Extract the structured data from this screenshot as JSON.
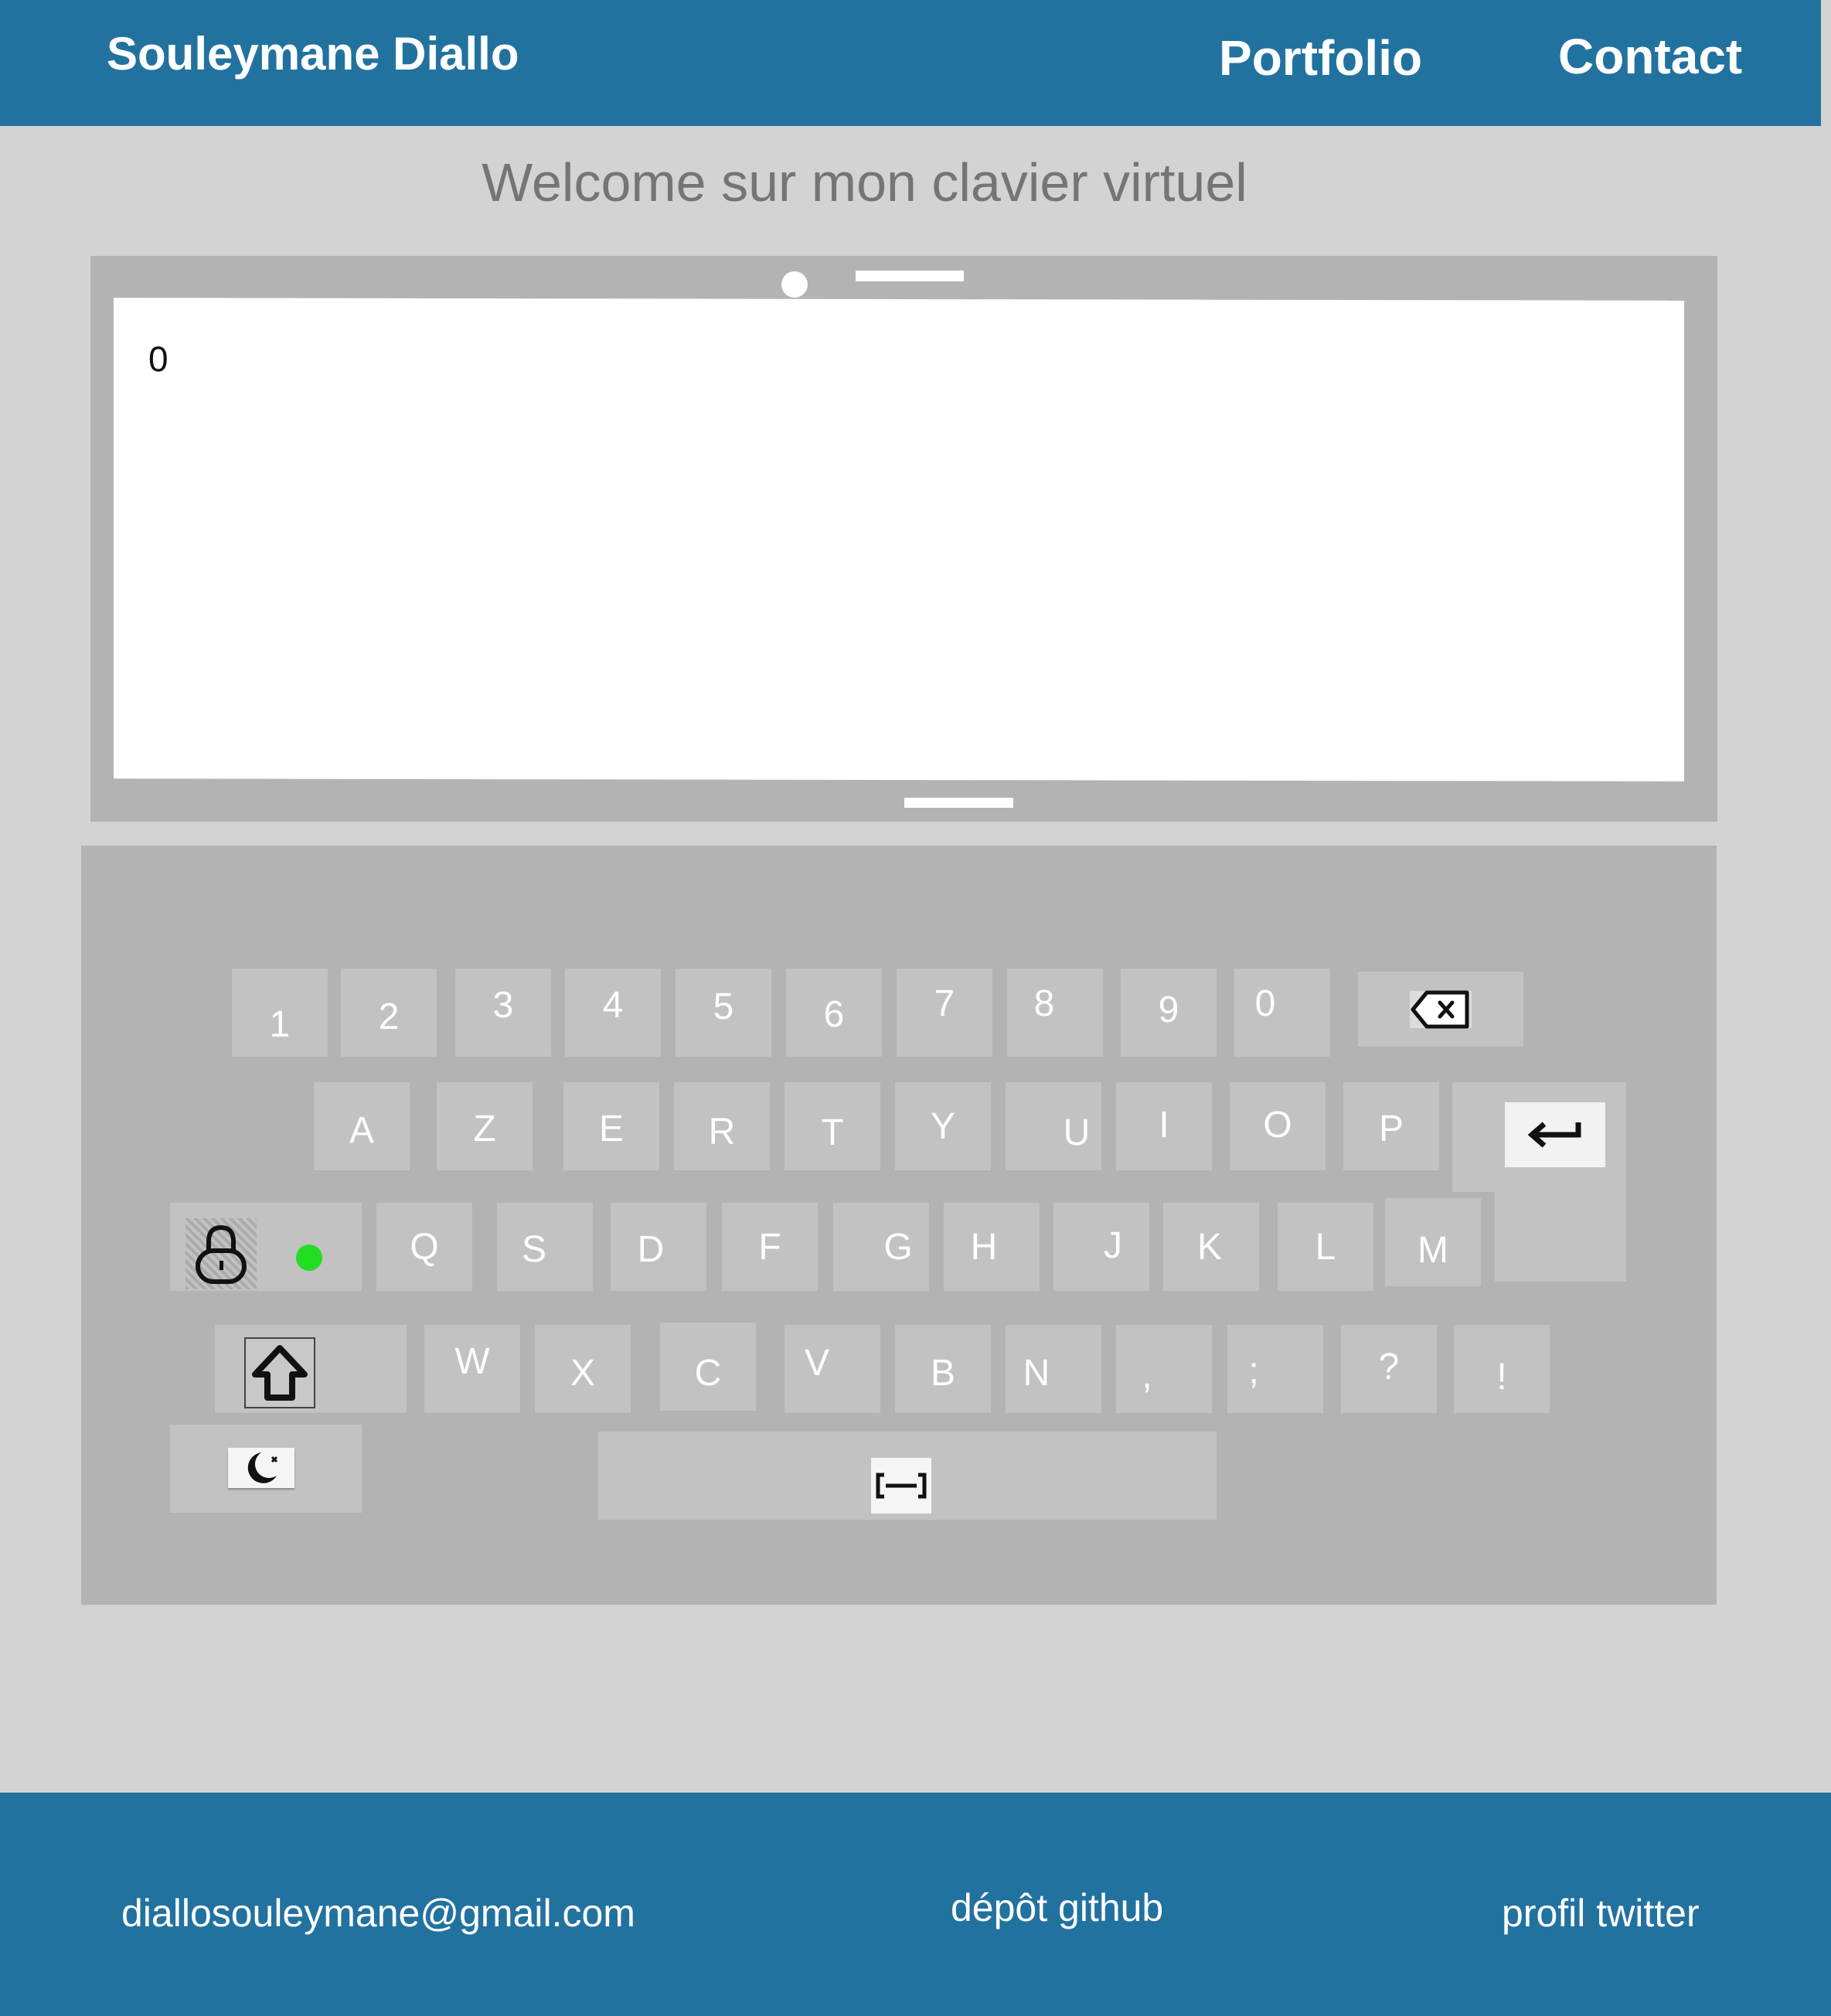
{
  "header": {
    "brand": "Souleymane Diallo",
    "nav": [
      {
        "label": "Portfolio"
      },
      {
        "label": "Contact"
      }
    ]
  },
  "welcome": "Welcome sur mon clavier virtuel",
  "display": {
    "text": "0"
  },
  "keyboard": {
    "row_numbers": [
      "1",
      "2",
      "3",
      "4",
      "5",
      "6",
      "7",
      "8",
      "9",
      "0"
    ],
    "row_top": [
      "A",
      "Z",
      "E",
      "R",
      "T",
      "Y",
      "U",
      "I",
      "O",
      "P"
    ],
    "row_middle": [
      "Q",
      "S",
      "D",
      "F",
      "G",
      "H",
      "J",
      "K",
      "L",
      "M"
    ],
    "row_bottom": [
      "W",
      "X",
      "C",
      "V",
      "B",
      "N",
      ",",
      ";",
      "?",
      "!"
    ],
    "icons": {
      "backspace": "backspace-icon",
      "enter": "enter-icon",
      "capslock": "lock-icon",
      "capslock_indicator_color": "#22dd22",
      "shift": "shift-icon",
      "theme": "moon-icon",
      "space": "space-icon"
    }
  },
  "footer": {
    "email": "diallosouleymane@gmail.com",
    "github": "dépôt github",
    "twitter": "profil twitter"
  },
  "colors": {
    "primary": "#2272a0",
    "background": "#d3d3d3",
    "frame": "#b3b3b3",
    "key": "#c2c2c2"
  }
}
